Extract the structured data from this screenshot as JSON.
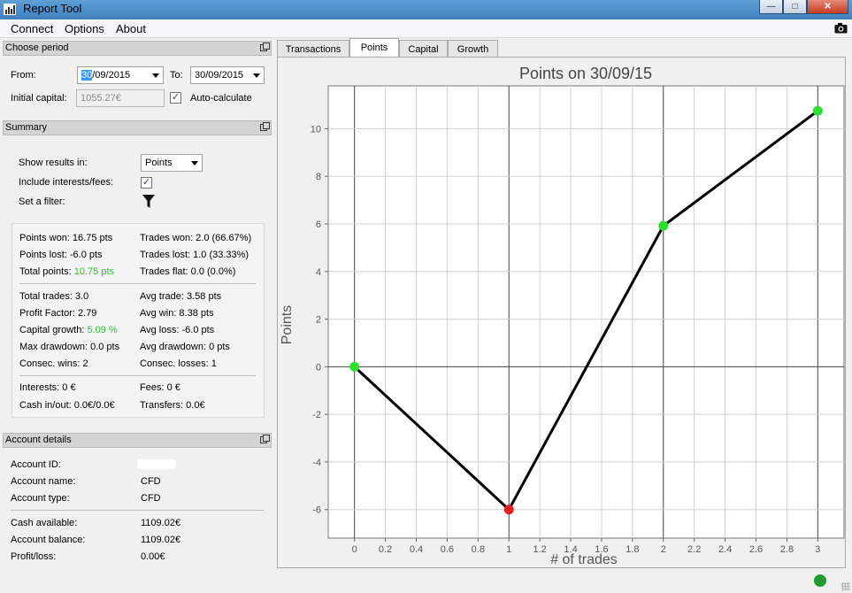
{
  "window": {
    "title": "Report Tool",
    "minimize": "—",
    "maximize": "□",
    "close": "✕"
  },
  "menu": {
    "items": [
      "Connect",
      "Options",
      "About"
    ]
  },
  "period": {
    "header": "Choose period",
    "from_label": "From:",
    "from_day": "30",
    "from_rest": "/09/2015",
    "to_label": "To:",
    "to_value": "30/09/2015",
    "initial_capital_label": "Initial capital:",
    "initial_capital_value": "1055.27€",
    "auto_calculate_label": "Auto-calculate",
    "auto_calculate_checked": true
  },
  "summary": {
    "header": "Summary",
    "show_results_label": "Show results in:",
    "show_results_value": "Points",
    "include_fees_label": "Include interests/fees:",
    "include_fees_checked": true,
    "filter_label": "Set a filter:",
    "stats": {
      "points_won": "Points won: 16.75 pts",
      "trades_won": "Trades won: 2.0 (66.67%)",
      "points_lost": "Points lost: -6.0 pts",
      "trades_lost": "Trades lost: 1.0 (33.33%)",
      "total_points_label": "Total points:",
      "total_points_value": "10.75 pts",
      "trades_flat": "Trades flat: 0.0 (0.0%)",
      "total_trades": "Total trades: 3.0",
      "avg_trade": "Avg trade: 3.58 pts",
      "profit_factor": "Profit Factor: 2.79",
      "avg_win": "Avg win: 8.38 pts",
      "capital_growth_label": "Capital growth:",
      "capital_growth_value": "5.09 %",
      "avg_loss": "Avg loss: -6.0 pts",
      "max_drawdown": "Max drawdown: 0.0 pts",
      "avg_drawdown": "Avg drawdown: 0 pts",
      "consec_wins": "Consec. wins: 2",
      "consec_losses": "Consec. losses: 1",
      "interests": "Interests: 0 €",
      "fees": "Fees: 0 €",
      "cash_in_out": "Cash in/out: 0.0€/0.0€",
      "transfers": "Transfers: 0.0€"
    }
  },
  "account": {
    "header": "Account details",
    "id_label": "Account ID:",
    "name_label": "Account name:",
    "name_value": "CFD",
    "type_label": "Account type:",
    "type_value": "CFD",
    "cash_label": "Cash available:",
    "cash_value": "1109.02€",
    "balance_label": "Account balance:",
    "balance_value": "1109.02€",
    "pl_label": "Profit/loss:",
    "pl_value": "0.00€"
  },
  "tabs": [
    "Transactions",
    "Points",
    "Capital",
    "Growth"
  ],
  "active_tab": "Points",
  "colors": {
    "win": "#2ee02e",
    "loss": "#e01f1f",
    "line": "#000000",
    "positive_text": "#2fbf2f"
  },
  "chart_data": {
    "type": "line",
    "title": "Points on 30/09/15",
    "xlabel": "# of trades",
    "ylabel": "Points",
    "x": [
      0,
      1,
      2,
      3
    ],
    "y": [
      0,
      -6,
      5.92,
      10.75
    ],
    "point_colors": [
      "win",
      "loss",
      "win",
      "win"
    ],
    "xlim": [
      -0.17,
      3.17
    ],
    "ylim": [
      -7.2,
      11.8
    ],
    "xticks": [
      0,
      0.2,
      0.4,
      0.6,
      0.8,
      1,
      1.2,
      1.4,
      1.6,
      1.8,
      2,
      2.2,
      2.4,
      2.6,
      2.8,
      3
    ],
    "yticks": [
      -6,
      -4,
      -2,
      0,
      2,
      4,
      6,
      8,
      10
    ],
    "grid": true
  }
}
